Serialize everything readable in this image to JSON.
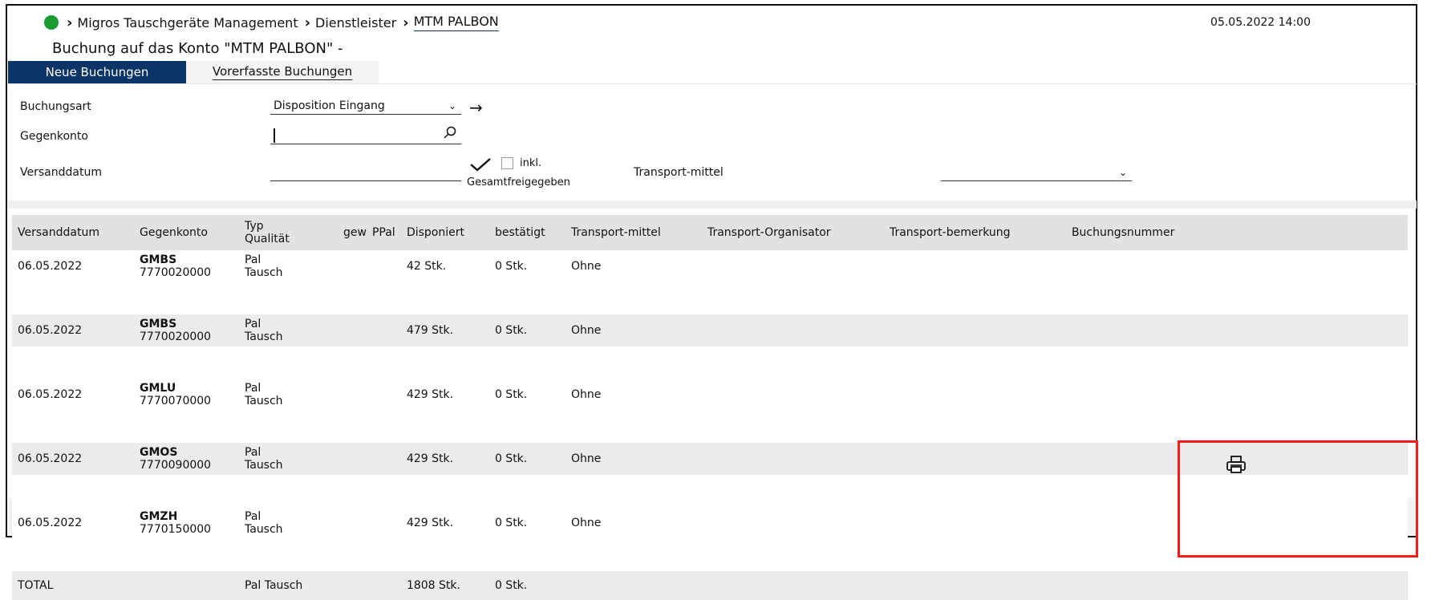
{
  "breadcrumb": {
    "root": "Migros Tauschgeräte Management",
    "middle": "Dienstleister",
    "current": "MTM PALBON"
  },
  "datetime": "05.05.2022 14:00",
  "page_title": "Buchung auf das Konto \"MTM PALBON\" -",
  "tabs": {
    "new": "Neue Buchungen",
    "pre": "Vorerfasste Buchungen"
  },
  "form": {
    "buchungsart_label": "Buchungsart",
    "buchungsart_value": "Disposition Eingang",
    "gegenkonto_label": "Gegenkonto",
    "gegenkonto_value": "",
    "versanddatum_label": "Versanddatum",
    "versanddatum_value": "",
    "inkl_label": "inkl.",
    "gesamt_label": "Gesamtfreigegeben",
    "transport_label": "Transport-mittel",
    "transport_value": ""
  },
  "table": {
    "headers": {
      "versanddatum": "Versanddatum",
      "gegenkonto": "Gegenkonto",
      "typ_line1": "Typ",
      "typ_line2": "Qualität",
      "gew": "gew",
      "ppal": "PPal",
      "disponiert": "Disponiert",
      "bestaetigt": "bestätigt",
      "transportmittel": "Transport-mittel",
      "organisator": "Transport-Organisator",
      "bemerkung": "Transport-bemerkung",
      "buchungsnummer": "Buchungsnummer"
    },
    "rows": [
      {
        "date": "06.05.2022",
        "konto_code": "GMBS",
        "konto_num": "7770020000",
        "typ": "Pal",
        "qual": "Tausch",
        "disponiert": "42 Stk.",
        "bestaetigt": "0 Stk.",
        "transport": "Ohne"
      },
      {
        "date": "06.05.2022",
        "konto_code": "GMBS",
        "konto_num": "7770020000",
        "typ": "Pal",
        "qual": "Tausch",
        "disponiert": "479 Stk.",
        "bestaetigt": "0 Stk.",
        "transport": "Ohne"
      },
      {
        "date": "06.05.2022",
        "konto_code": "GMLU",
        "konto_num": "7770070000",
        "typ": "Pal",
        "qual": "Tausch",
        "disponiert": "429 Stk.",
        "bestaetigt": "0 Stk.",
        "transport": "Ohne"
      },
      {
        "date": "06.05.2022",
        "konto_code": "GMOS",
        "konto_num": "7770090000",
        "typ": "Pal",
        "qual": "Tausch",
        "disponiert": "429 Stk.",
        "bestaetigt": "0 Stk.",
        "transport": "Ohne"
      },
      {
        "date": "06.05.2022",
        "konto_code": "GMZH",
        "konto_num": "7770150000",
        "typ": "Pal",
        "qual": "Tausch",
        "disponiert": "429 Stk.",
        "bestaetigt": "0 Stk.",
        "transport": "Ohne"
      }
    ],
    "total": {
      "label": "TOTAL",
      "typ": "Pal Tausch",
      "disponiert": "1808 Stk.",
      "bestaetigt": "0 Stk."
    }
  },
  "icons": {
    "status": "green-status-dot-icon",
    "breadcrumb_sep": "chevron-right-icon",
    "dropdown": "chevron-down-icon",
    "go": "arrow-right-icon",
    "search": "search-icon",
    "confirm": "checkmark-icon",
    "print": "printer-icon"
  },
  "colors": {
    "status_green": "#1a9b2e",
    "tab_active": "#0b3566",
    "highlight_box": "#ff1a1a"
  }
}
